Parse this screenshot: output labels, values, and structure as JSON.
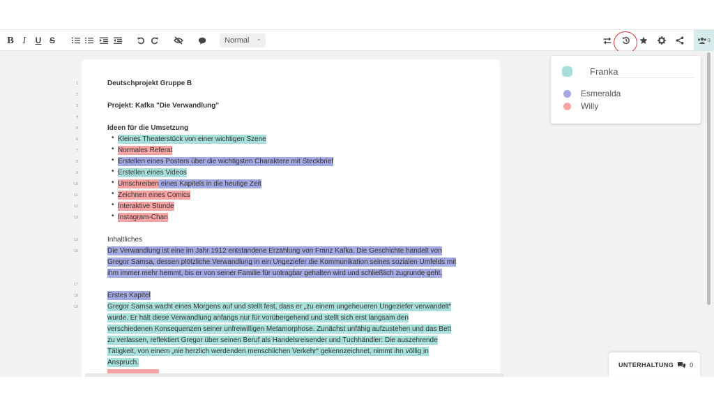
{
  "toolbar": {
    "bold": "B",
    "italic": "I",
    "underline": "U",
    "strike": "S",
    "format_select": "Normal",
    "users_count": "3"
  },
  "participants": [
    {
      "name": "Franka",
      "color": "#a6dfdc"
    },
    {
      "name": "Esmeralda",
      "color": "#a4a8e3"
    },
    {
      "name": "Willy",
      "color": "#f7a3a3"
    }
  ],
  "document": {
    "lines": [
      {
        "num": "1",
        "text": "Deutschprojekt Gruppe B"
      },
      {
        "num": "2",
        "text": ""
      },
      {
        "num": "3",
        "text": "Projekt: Kafka \"Die Verwandlung\""
      },
      {
        "num": "4",
        "text": ""
      },
      {
        "num": "5",
        "text": "Ideen für die Umsetzung"
      },
      {
        "num": "6",
        "text": "Kleines Theaterstück von einer wichtigen Szene"
      },
      {
        "num": "7",
        "text": "Normales Referat"
      },
      {
        "num": "8",
        "text": "Erstellen eines Posters über die wichtigsten Charaktere mit Steckbrief"
      },
      {
        "num": "9",
        "text": "Erstellen eines Videos"
      },
      {
        "num": "10",
        "text": "Umschreiben",
        "text2": "eines Kapitels in die heutige Zeit"
      },
      {
        "num": "11",
        "text": "Zeichnen eines Comics"
      },
      {
        "num": "12",
        "text": "Interaktive Stunde"
      },
      {
        "num": "13",
        "text": "Instagram-Chan"
      },
      {
        "num": "13",
        "text": "Inhaltliches"
      },
      {
        "num": "16",
        "text": "Die Verwandlung ist eine im Jahr 1912 entstandene Erzählung von Franz Kafka. Die Geschichte handelt von"
      },
      {
        "num": "",
        "text": "Gregor Samsa, dessen plötzliche Verwandlung in ein Ungeziefer die Kommunikation seines sozialen Umfelds mit"
      },
      {
        "num": "",
        "text": "ihm immer mehr hemmt, bis er von seiner Familie für untragbar gehalten wird und schließlich zugrunde geht."
      },
      {
        "num": "17",
        "text": ""
      },
      {
        "num": "18",
        "text": "Erstes Kapitel"
      },
      {
        "num": "19",
        "text": "Gregor Samsa wacht eines Morgens auf und stellt fest, dass er „zu einem ungeheueren Ungeziefer verwandelt“"
      },
      {
        "num": "",
        "text": "wurde. Er hält diese Verwandlung anfangs nur für vorübergehend und stellt sich erst langsam den"
      },
      {
        "num": "",
        "text": "verschiedenen Konsequenzen seiner unfreiwilligen Metamorphose. Zunächst unfähig aufzustehen und das Bett"
      },
      {
        "num": "",
        "text": "zu verlassen, reflektiert Gregor über seinen Beruf als Handelsreisender und Tuchhändler: Die auszehrende"
      },
      {
        "num": "",
        "text": "Tätigkeit, von einem „nie herzlich werdenden menschlichen Verkehr“ gekennzeichnet, nimmt ihn völlig in"
      },
      {
        "num": "",
        "text": "Anspruch."
      }
    ]
  },
  "chat": {
    "label": "UNTERHALTUNG",
    "count": "0"
  }
}
